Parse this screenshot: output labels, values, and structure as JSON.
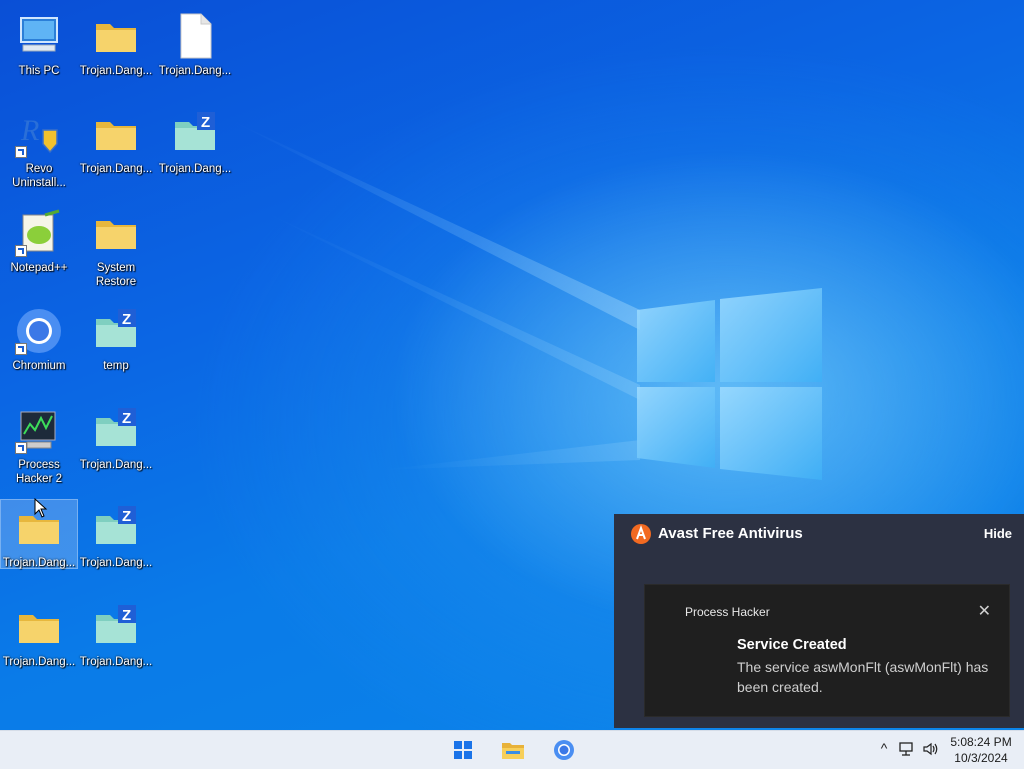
{
  "desktop": {
    "icons": [
      {
        "label": "This PC",
        "icon": "computer-icon"
      },
      {
        "label": "Trojan.Dang...",
        "icon": "folder-icon"
      },
      {
        "label": "Trojan.Dang...",
        "icon": "file-icon"
      },
      {
        "label": "Revo Uninstall...",
        "icon": "revo-uninstaller-icon"
      },
      {
        "label": "Trojan.Dang...",
        "icon": "folder-icon"
      },
      {
        "label": "Trojan.Dang...",
        "icon": "zip-folder-icon"
      },
      {
        "label": "Notepad++",
        "icon": "notepad-plus-plus-icon"
      },
      {
        "label": "System Restore",
        "icon": "folder-icon"
      },
      {
        "label": "Chromium",
        "icon": "chromium-icon"
      },
      {
        "label": "temp",
        "icon": "zip-folder-icon"
      },
      {
        "label": "Process Hacker 2",
        "icon": "process-hacker-icon"
      },
      {
        "label": "Trojan.Dang...",
        "icon": "zip-folder-icon"
      },
      {
        "label": "Trojan.Dang...",
        "icon": "folder-icon"
      },
      {
        "label": "Trojan.Dang...",
        "icon": "zip-folder-icon"
      },
      {
        "label": "Trojan.Dang...",
        "icon": "folder-icon"
      },
      {
        "label": "Trojan.Dang...",
        "icon": "zip-folder-icon"
      }
    ]
  },
  "avast": {
    "title": "Avast Free Antivirus",
    "hide_label": "Hide",
    "accent": "#f26a21",
    "toast": {
      "app": "Process Hacker",
      "close": "✕",
      "title": "Service Created",
      "body": "The service aswMonFlt (aswMonFlt) has been created."
    }
  },
  "taskbar": {
    "items": [
      "start-icon",
      "file-explorer-icon",
      "chromium-icon"
    ],
    "tray": [
      "chevron-up-icon",
      "network-icon",
      "volume-icon"
    ],
    "chevron": "^",
    "time": "5:08:24 PM",
    "date": "10/3/2024"
  }
}
